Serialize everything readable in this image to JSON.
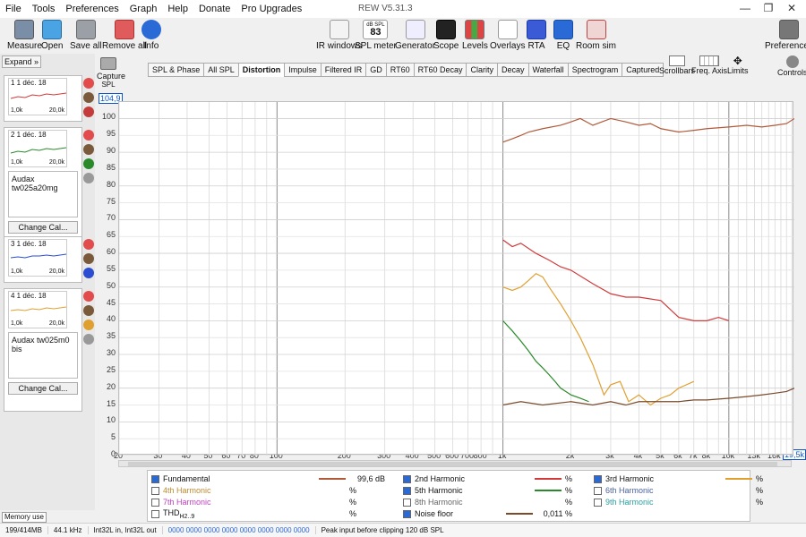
{
  "app": {
    "title": "REW V5.31.3"
  },
  "menu": [
    "File",
    "Tools",
    "Preferences",
    "Graph",
    "Help",
    "Donate",
    "Pro Upgrades"
  ],
  "toolbar": {
    "measure": "Measure",
    "open": "Open",
    "save_all": "Save all",
    "remove_all": "Remove all",
    "info": "Info",
    "ir_windows": "IR windows",
    "spl_meter_top": "dB SPL",
    "spl_meter_value": "83",
    "spl_meter": "SPL meter",
    "generator": "Generator",
    "scope": "Scope",
    "levels": "Levels",
    "overlays": "Overlays",
    "rta": "RTA",
    "eq": "EQ",
    "room_sim": "Room sim",
    "preferences": "Preferences"
  },
  "left": {
    "expand": "Expand",
    "cards": [
      {
        "title": "1 1 déc. 18",
        "l": "1,0k",
        "r": "20,0k",
        "note": "",
        "color": "#d23a3a"
      },
      {
        "title": "2 1 déc. 18",
        "l": "1,0k",
        "r": "20,0k",
        "note": "Audax tw025a20mg",
        "color": "#2a8a2a"
      },
      {
        "title": "3 1 déc. 18",
        "l": "1,0k",
        "r": "20,0k",
        "note": "",
        "color": "#2b4dd1"
      },
      {
        "title": "4 1 déc. 18",
        "l": "1,0k",
        "r": "20,0k",
        "note": "Audax tw025m0 bis",
        "color": "#e0a030"
      }
    ],
    "change_cal": "Change Cal..."
  },
  "capture": {
    "label": "Capture",
    "spl": "SPL"
  },
  "tabs": [
    "SPL & Phase",
    "All SPL",
    "Distortion",
    "Impulse",
    "Filtered IR",
    "GD",
    "RT60",
    "RT60 Decay",
    "Clarity",
    "Decay",
    "Waterfall",
    "Spectrogram",
    "Captured"
  ],
  "active_tab": "Distortion",
  "right_controls": {
    "scrollbars": "Scrollbars",
    "freq_axis": "Freq. Axis",
    "limits": "Limits",
    "controls": "Controls"
  },
  "graph": {
    "y_top": "104,9",
    "x_right": "19,5k"
  },
  "legend": {
    "rows": [
      [
        {
          "label": "Fundamental",
          "checked": true,
          "color": "#b05a3a",
          "value": "99,6 dB",
          "unit": ""
        },
        {
          "label": "2nd Harmonic",
          "checked": true,
          "color": "#d23a3a",
          "value": "",
          "unit": "%"
        },
        {
          "label": "3rd Harmonic",
          "checked": true,
          "color": "#e0a030",
          "value": "",
          "unit": "%"
        }
      ],
      [
        {
          "label": "4th Harmonic",
          "checked": false,
          "color": "#e0a030",
          "value": "",
          "unit": "%"
        },
        {
          "label": "5th Harmonic",
          "checked": true,
          "color": "#2a8a2a",
          "value": "",
          "unit": "%"
        },
        {
          "label": "6th Harmonic",
          "checked": false,
          "color": "#4a60a0",
          "value": "",
          "unit": "%"
        }
      ],
      [
        {
          "label": "7th Harmonic",
          "checked": false,
          "color": "#c040c0",
          "value": "",
          "unit": "%"
        },
        {
          "label": "8th Harmonic",
          "checked": false,
          "color": "#666666",
          "value": "",
          "unit": "%"
        },
        {
          "label": "9th Harmonic",
          "checked": false,
          "color": "#2aa0a0",
          "value": "",
          "unit": "%"
        }
      ],
      [
        {
          "label": "THD",
          "sub": "H2..9",
          "checked": false,
          "color": "#000000",
          "value": "",
          "unit": "%"
        },
        {
          "label": "Noise floor",
          "checked": true,
          "color": "#7a4a2a",
          "value": "0,011 %",
          "unit": ""
        }
      ]
    ]
  },
  "status": {
    "memory_btn": "Memory use",
    "mem": "199/414MB",
    "rate": "44.1 kHz",
    "io": "Int32L in, Int32L out",
    "hex": "0000 0000  0000 0000  0000 0000  0000 0000",
    "peak": "Peak input before clipping 120 dB SPL"
  },
  "chart_data": {
    "type": "line",
    "x_scale": "log",
    "xlim": [
      20,
      19500
    ],
    "ylim": [
      0,
      104.9
    ],
    "x_ticks": [
      "20",
      "30",
      "40",
      "50",
      "60",
      "70",
      "80",
      "100",
      "200",
      "300",
      "400",
      "500",
      "600",
      "700",
      "800",
      "1k",
      "2k",
      "3k",
      "4k",
      "5k",
      "6k",
      "7k",
      "8k",
      "10k",
      "13k",
      "16k",
      "19,5k"
    ],
    "y_ticks": [
      0,
      5,
      10,
      15,
      20,
      25,
      30,
      35,
      40,
      45,
      50,
      55,
      60,
      65,
      70,
      75,
      80,
      85,
      90,
      95,
      100
    ],
    "series": [
      {
        "name": "Fundamental",
        "color": "#b05a3a",
        "x": [
          1000,
          1100,
          1200,
          1300,
          1500,
          1800,
          2000,
          2200,
          2500,
          3000,
          3500,
          4000,
          4500,
          5000,
          6000,
          7000,
          8000,
          10000,
          12000,
          14000,
          16000,
          18000,
          19500
        ],
        "y": [
          93,
          94,
          95,
          96,
          97,
          98,
          99,
          100,
          98,
          100,
          99,
          98,
          98.5,
          97,
          96,
          96.5,
          97,
          97.5,
          98,
          97.5,
          98,
          98.5,
          100
        ]
      },
      {
        "name": "2nd Harmonic",
        "color": "#d23a3a",
        "x": [
          1000,
          1100,
          1200,
          1400,
          1600,
          1800,
          2000,
          2500,
          3000,
          3500,
          4000,
          5000,
          6000,
          7000,
          8000,
          9000,
          10000
        ],
        "y": [
          64,
          62,
          63,
          60,
          58,
          56,
          55,
          51,
          48,
          47,
          47,
          46,
          41,
          40,
          40,
          41,
          40
        ]
      },
      {
        "name": "3rd Harmonic",
        "color": "#e0a030",
        "x": [
          1000,
          1100,
          1200,
          1300,
          1400,
          1500,
          1600,
          1800,
          2000,
          2200,
          2500,
          2800,
          3000,
          3300,
          3600,
          4000,
          4500,
          5000,
          5500,
          6000,
          7000
        ],
        "y": [
          50,
          49,
          50,
          52,
          54,
          53,
          50,
          45,
          40,
          35,
          27,
          18,
          21,
          22,
          16,
          18,
          15,
          17,
          18,
          20,
          22
        ]
      },
      {
        "name": "5th Harmonic",
        "color": "#2a8a2a",
        "x": [
          1000,
          1100,
          1200,
          1300,
          1400,
          1500,
          1600,
          1700,
          1800,
          1900,
          2000,
          2200,
          2400
        ],
        "y": [
          40,
          37,
          34,
          31,
          28,
          26,
          24,
          22,
          20,
          19,
          18,
          17,
          16
        ]
      },
      {
        "name": "Noise floor",
        "color": "#7a4a2a",
        "x": [
          1000,
          1200,
          1500,
          2000,
          2500,
          3000,
          3500,
          4000,
          5000,
          6000,
          7000,
          8000,
          10000,
          12000,
          14000,
          16000,
          18000,
          19500
        ],
        "y": [
          15,
          16,
          15,
          16,
          15,
          16,
          15,
          16,
          16,
          16,
          16.5,
          16.5,
          17,
          17.5,
          18,
          18.5,
          19,
          20
        ]
      }
    ]
  }
}
